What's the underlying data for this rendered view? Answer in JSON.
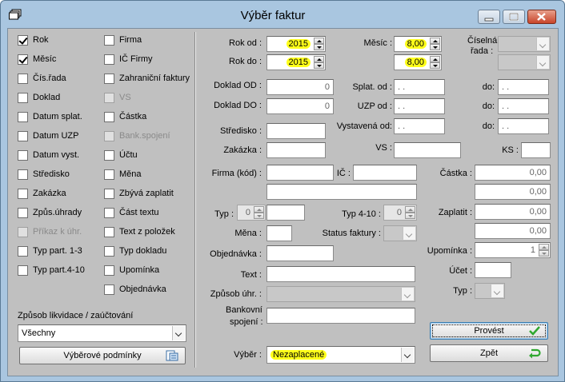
{
  "window": {
    "title": "Výběr faktur"
  },
  "left_checkboxes": [
    {
      "label": "Rok",
      "checked": true,
      "disabled": false
    },
    {
      "label": "Měsíc",
      "checked": true,
      "disabled": false
    },
    {
      "label": "Čís.řada",
      "checked": false,
      "disabled": false
    },
    {
      "label": "Doklad",
      "checked": false,
      "disabled": false
    },
    {
      "label": "Datum splat.",
      "checked": false,
      "disabled": false
    },
    {
      "label": "Datum UZP",
      "checked": false,
      "disabled": false
    },
    {
      "label": "Datum vyst.",
      "checked": false,
      "disabled": false
    },
    {
      "label": "Středisko",
      "checked": false,
      "disabled": false
    },
    {
      "label": "Zakázka",
      "checked": false,
      "disabled": false
    },
    {
      "label": "Způs.úhrady",
      "checked": false,
      "disabled": false
    },
    {
      "label": "Příkaz k úhr.",
      "checked": false,
      "disabled": true
    },
    {
      "label": "Typ part. 1-3",
      "checked": false,
      "disabled": false
    },
    {
      "label": "Typ part.4-10",
      "checked": false,
      "disabled": false
    }
  ],
  "mid_checkboxes": [
    {
      "label": "Firma",
      "checked": false,
      "disabled": false
    },
    {
      "label": "IČ Firmy",
      "checked": false,
      "disabled": false
    },
    {
      "label": "Zahraniční faktury",
      "checked": false,
      "disabled": false
    },
    {
      "label": "VS",
      "checked": false,
      "disabled": true
    },
    {
      "label": "Částka",
      "checked": false,
      "disabled": false
    },
    {
      "label": "Bank.spojení",
      "checked": false,
      "disabled": true
    },
    {
      "label": "Účtu",
      "checked": false,
      "disabled": false
    },
    {
      "label": "Měna",
      "checked": false,
      "disabled": false
    },
    {
      "label": "Zbývá zaplatit",
      "checked": false,
      "disabled": false
    },
    {
      "label": "Část textu",
      "checked": false,
      "disabled": false
    },
    {
      "label": "Text z položek",
      "checked": false,
      "disabled": false
    },
    {
      "label": "Typ dokladu",
      "checked": false,
      "disabled": false
    },
    {
      "label": "Upomínka",
      "checked": false,
      "disabled": false
    },
    {
      "label": "Objednávka",
      "checked": false,
      "disabled": false
    }
  ],
  "liquidation": {
    "label": "Způsob likvidace / zaúčtování",
    "value": "Všechny"
  },
  "conditions_button": "Výběrové podmínky",
  "form": {
    "rok_od_label": "Rok od :",
    "rok_od": "2015",
    "rok_do_label": "Rok do :",
    "rok_do": "2015",
    "mesic_label": "Měsíc :",
    "mesic_od": "8,00",
    "mesic_do": "8,00",
    "ciselna_label_1": "Číselná",
    "ciselna_label_2": "řada :",
    "doklad_od_label": "Doklad OD :",
    "doklad_od": "0",
    "doklad_do_label": "Doklad DO :",
    "doklad_do": "0",
    "splat_od_label": "Splat. od :",
    "splat_od": ". .",
    "uzp_od_label": "UZP od :",
    "uzp_od": ". .",
    "vyst_od_label": "Vystavená od:",
    "vyst_od": ". .",
    "do_label": "do:",
    "splat_do": ". .",
    "uzp_do": ". .",
    "vyst_do": ". .",
    "stredisko_label": "Středisko :",
    "zakazka_label": "Zakázka :",
    "vs_label": "VS :",
    "ks_label": "KS :",
    "firma_label": "Firma (kód) :",
    "ic_label": "IČ :",
    "castka_label": "Částka :",
    "castka_od": "0,00",
    "castka_do": "0,00",
    "typ_label": "Typ :",
    "typ_value": "0",
    "typ410_label": "Typ 4-10 :",
    "typ410_value": "0",
    "zaplatit_label": "Zaplatit :",
    "zaplatit_od": "0,00",
    "zaplatit_do": "0,00",
    "mena_label": "Měna :",
    "status_label": "Status faktury :",
    "objednavka_label": "Objednávka :",
    "upominka_label": "Upomínka :",
    "upominka_value": "1",
    "ucet_label": "Účet :",
    "text_label": "Text :",
    "typ2_label": "Typ :",
    "zpusob_label": "Způsob úhr. :",
    "bank_label_1": "Bankovní",
    "bank_label_2": "spojení :",
    "vyber_label": "Výběr :",
    "vyber_value": "Nezaplacené"
  },
  "buttons": {
    "provest": "Provést",
    "zpet": "Zpět"
  },
  "colors": {
    "highlight": "#ffff1a",
    "ok_icon": "#2fa82f",
    "titlebar": "#a9c6e0"
  }
}
